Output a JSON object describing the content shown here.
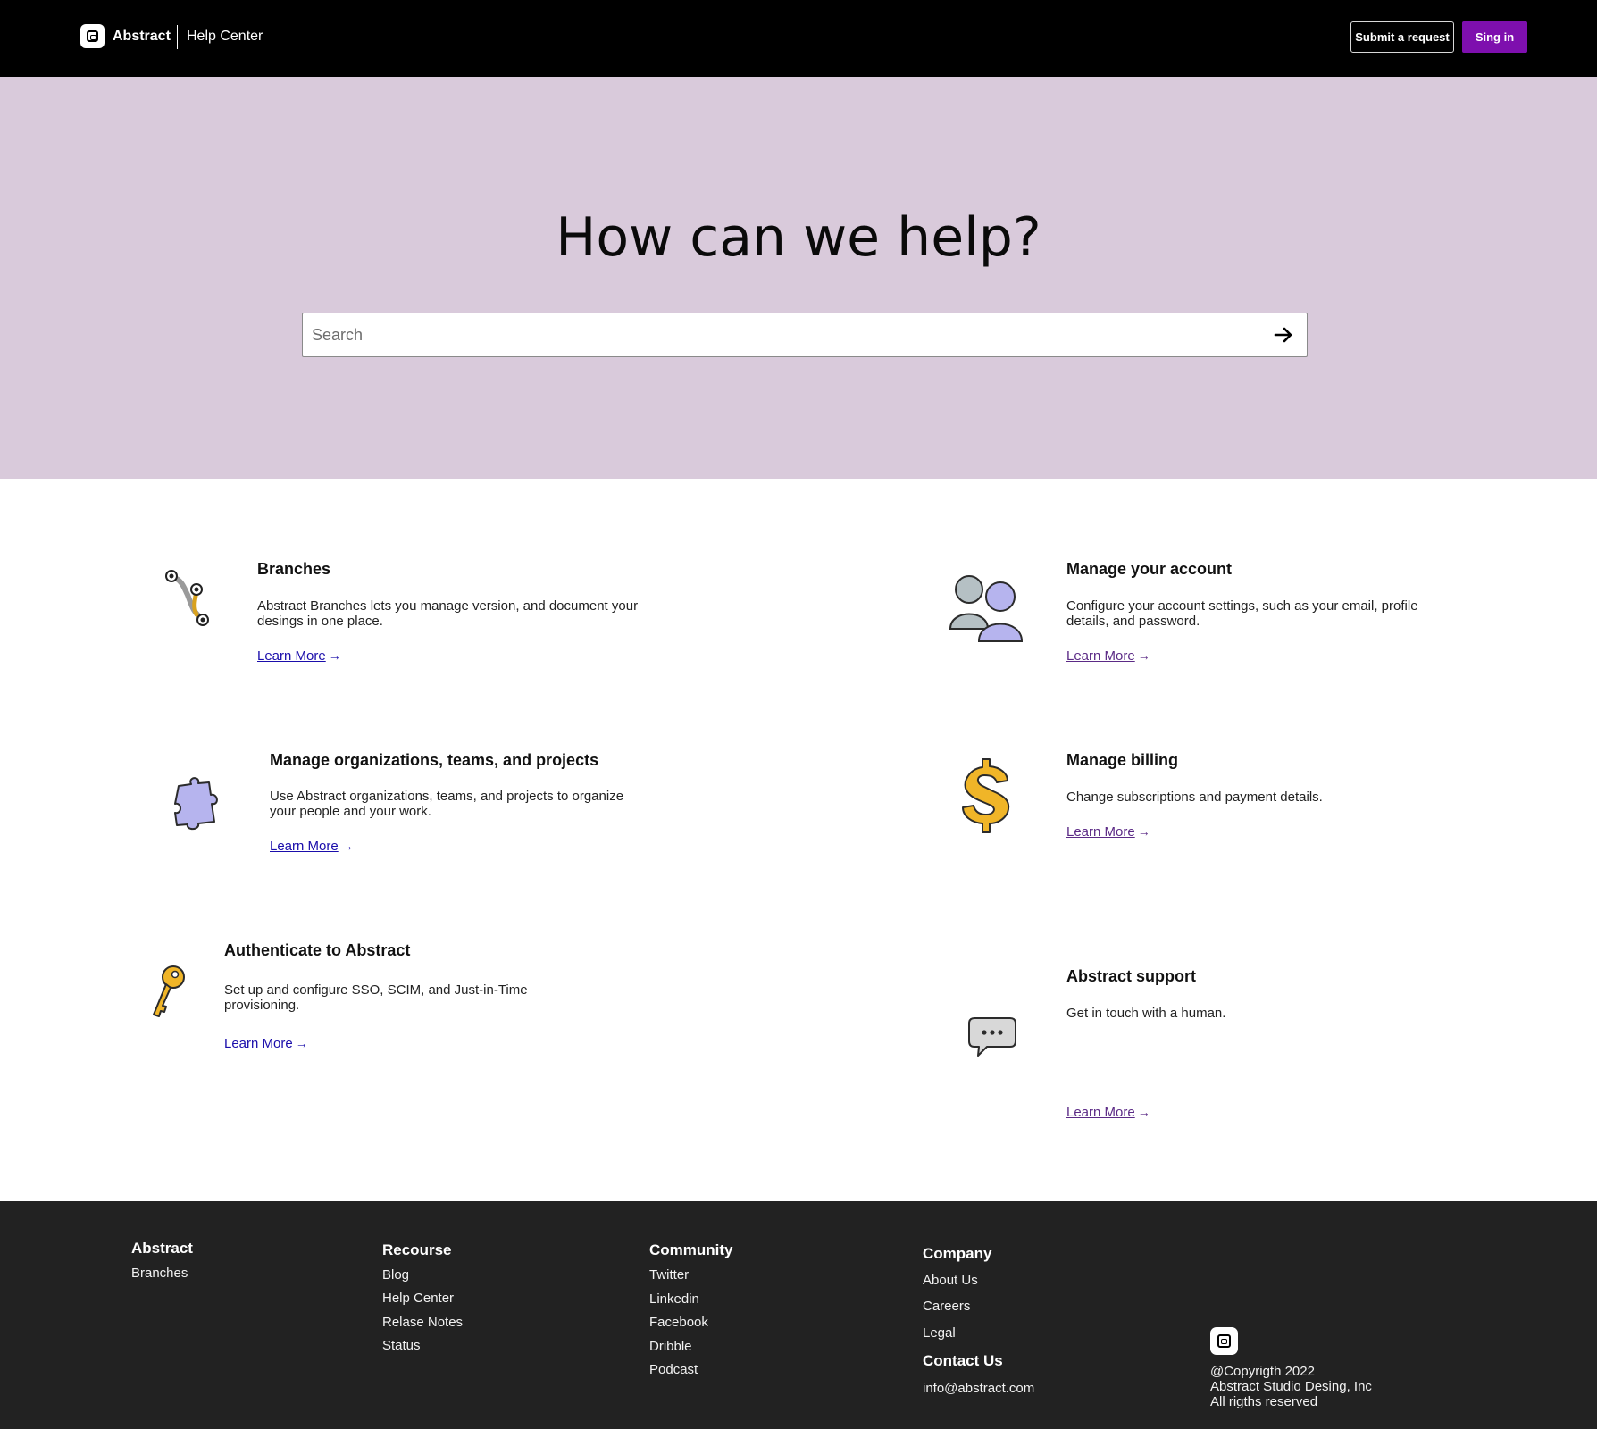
{
  "header": {
    "brand": "Abstract",
    "section": "Help Center",
    "submit_label": "Submit a request",
    "signin_label": "Sing in"
  },
  "hero": {
    "title": "How can we help?",
    "search_placeholder": "Search"
  },
  "cards": [
    {
      "title": "Branches",
      "desc": "Abstract Branches lets you manage version, and document your desings in one place.",
      "link": "Learn More",
      "icon": "branches-icon"
    },
    {
      "title": "Manage your account",
      "desc": "Configure your account settings, such as your email, profile details, and password.",
      "link": "Learn More",
      "icon": "users-icon"
    },
    {
      "title": "Manage organizations, teams, and projects",
      "desc": "Use Abstract organizations, teams, and projects to organize your people and your work.",
      "link": "Learn More",
      "icon": "puzzle-icon"
    },
    {
      "title": "Manage billing",
      "desc": "Change subscriptions and payment details.",
      "link": "Learn More",
      "icon": "dollar-icon"
    },
    {
      "title": "Authenticate to Abstract",
      "desc": "Set up and configure SSO, SCIM, and Just-in-Time provisioning.",
      "link": "Learn More",
      "icon": "key-icon"
    },
    {
      "title": "Abstract support",
      "desc": "Get in touch with a human.",
      "link": "Learn More",
      "icon": "chat-bubble-icon"
    }
  ],
  "footer": {
    "abstract": {
      "heading": "Abstract",
      "items": [
        "Branches"
      ]
    },
    "resource": {
      "heading": "Recourse",
      "items": [
        "Blog",
        "Help Center",
        "Relase Notes",
        "Status"
      ]
    },
    "community": {
      "heading": "Community",
      "items": [
        "Twitter",
        "Linkedin",
        "Facebook",
        "Dribble",
        "Podcast"
      ]
    },
    "company": {
      "heading": "Company",
      "items": [
        "About Us",
        "Careers",
        "Legal"
      ]
    },
    "contact": {
      "heading": "Contact Us",
      "email": "info@abstract.com"
    },
    "copyright": [
      "@Copyrigth 2022",
      "Abstract Studio Desing, Inc",
      "All rigths reserved"
    ]
  },
  "colors": {
    "header_bg": "#000000",
    "hero_bg": "#d9cadb",
    "accent": "#7e0fae",
    "footer_bg": "#222222",
    "link": "#1a0dab"
  }
}
